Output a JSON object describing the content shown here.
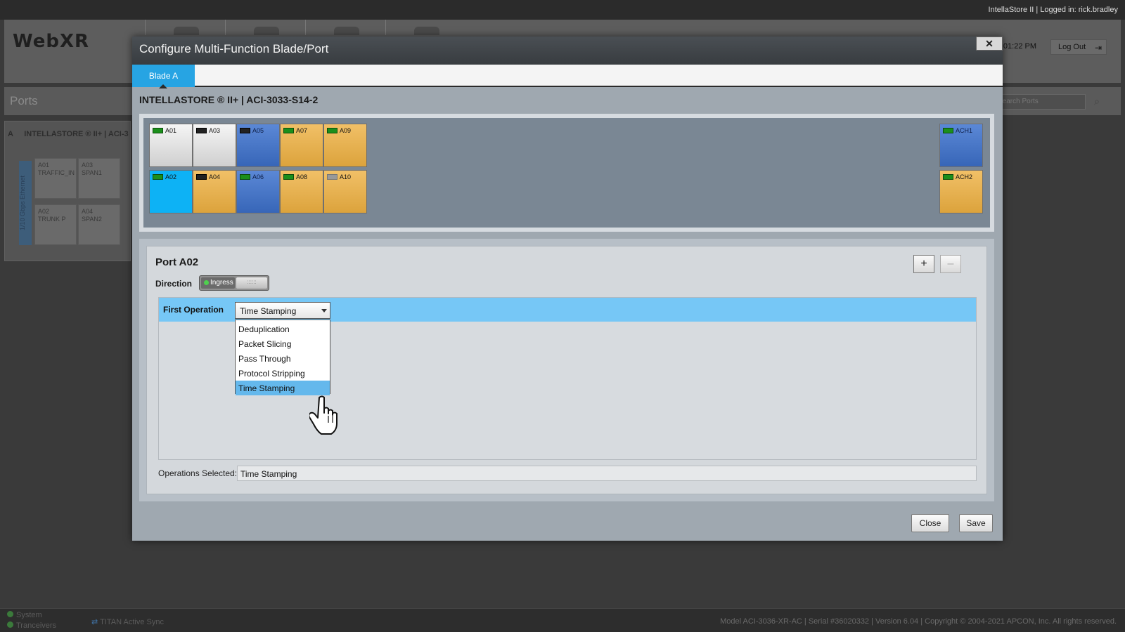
{
  "app": {
    "logo": "WebXR",
    "login_info": "IntellaStore II | Logged in: rick.bradley",
    "clock": "4:01:22 PM",
    "logout_label": "Log Out",
    "ports_title": "Ports",
    "search_placeholder": "Search Ports",
    "left_panel_letter": "A",
    "left_panel_title": "INTELLASTORE ® II+ | ACI-3",
    "left_strip": "1/10 Gbps Ethernet",
    "mini_ports": [
      {
        "id": "A01",
        "label": "TRAFFIC_IN"
      },
      {
        "id": "A03",
        "label": "SPAN1"
      },
      {
        "id": "A02",
        "label": "TRUNK P"
      },
      {
        "id": "A04",
        "label": "SPAN2"
      }
    ]
  },
  "footer": {
    "system": "System",
    "transceivers": "Tranceivers",
    "sync": "TITAN Active Sync",
    "model_info": "Model ACI-3036-XR-AC | Serial #36020332 | Version 6.04 | Copyright © 2004-2021 APCON, Inc. All rights reserved."
  },
  "dialog": {
    "title": "Configure Multi-Function Blade/Port",
    "close_icon": "✕",
    "tab": "Blade A",
    "device_title": "INTELLASTORE ® II+ | ACI-3033-S14-2",
    "ports_top": [
      {
        "id": "A01",
        "color": "white",
        "status": "up"
      },
      {
        "id": "A03",
        "color": "white",
        "status": "x"
      },
      {
        "id": "A05",
        "color": "blue",
        "status": "x"
      },
      {
        "id": "A07",
        "color": "orange",
        "status": "up"
      },
      {
        "id": "A09",
        "color": "orange",
        "status": "up"
      }
    ],
    "ports_bottom": [
      {
        "id": "A02",
        "color": "cyan",
        "status": "up"
      },
      {
        "id": "A04",
        "color": "orange",
        "status": "x"
      },
      {
        "id": "A06",
        "color": "blue",
        "status": "up"
      },
      {
        "id": "A08",
        "color": "orange",
        "status": "up"
      },
      {
        "id": "A10",
        "color": "orange",
        "status": "dim"
      }
    ],
    "ports_right": [
      {
        "id": "ACH1",
        "color": "blue",
        "status": "up"
      },
      {
        "id": "ACH2",
        "color": "orange",
        "status": "up"
      }
    ],
    "port_heading": "Port A02",
    "add_icon": "+",
    "remove_icon": "–",
    "direction_label": "Direction",
    "direction_value": "Ingress",
    "first_operation_label": "First Operation",
    "first_operation_value": "Time Stamping",
    "dropdown_options": [
      "Deduplication",
      "Packet Slicing",
      "Pass Through",
      "Protocol Stripping",
      "Time Stamping"
    ],
    "dropdown_selected": "Time Stamping",
    "operations_selected_label": "Operations Selected:",
    "operations_selected_value": "Time Stamping",
    "close_label": "Close",
    "save_label": "Save"
  },
  "colors": {
    "accent": "#27a4e3",
    "selected_row": "#76c7f6",
    "port_orange": "#e8b14f",
    "port_blue": "#4676c8",
    "port_cyan": "#0db2f5"
  }
}
